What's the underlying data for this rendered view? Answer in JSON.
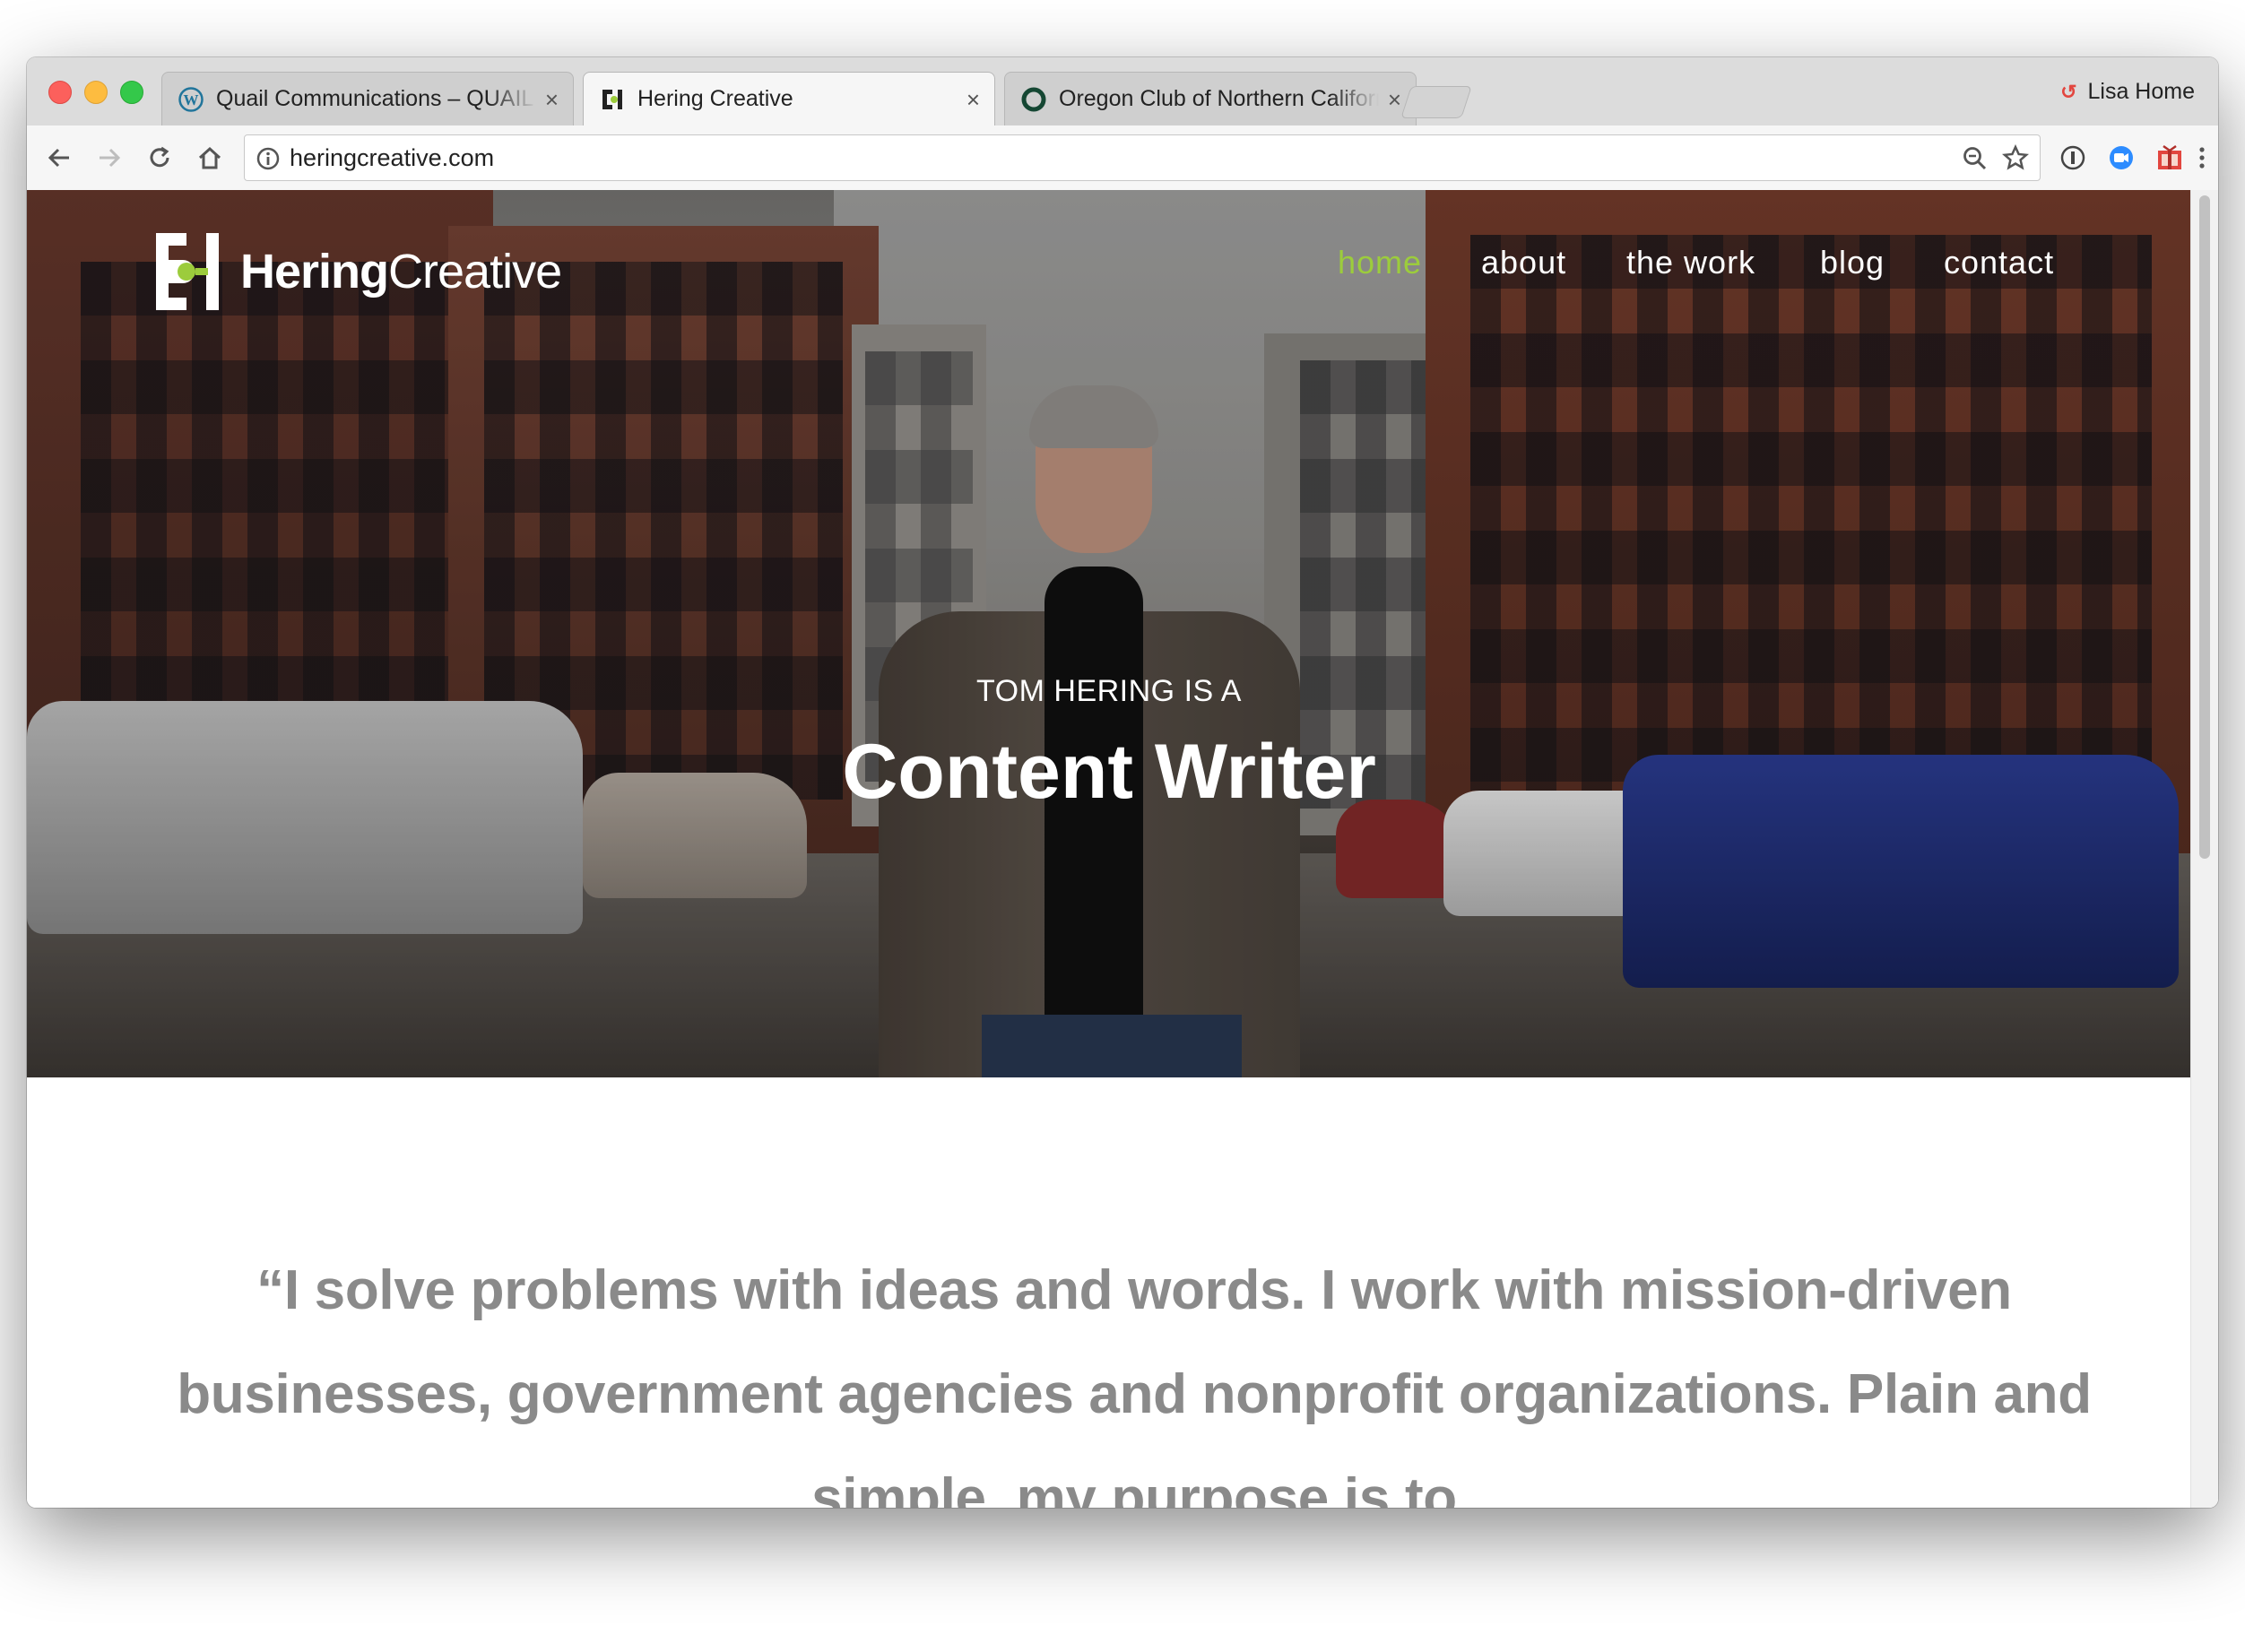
{
  "browser": {
    "tabs": [
      {
        "title": "Quail Communications – QUAIL",
        "favicon": "wordpress-icon",
        "active": false
      },
      {
        "title": "Hering Creative",
        "favicon": "hering-creative-icon",
        "active": true
      },
      {
        "title": "Oregon Club of Northern California",
        "favicon": "oregon-o-icon",
        "active": false
      }
    ],
    "profile_name": "Lisa Home",
    "url": "heringcreative.com",
    "colors": {
      "tabstrip": "#dcdcdc",
      "toolbar": "#f6f6f6"
    }
  },
  "site": {
    "logo": {
      "bold": "Hering",
      "light": "Creative"
    },
    "nav": [
      {
        "label": "home",
        "active": true
      },
      {
        "label": "about",
        "active": false
      },
      {
        "label": "the work",
        "active": false
      },
      {
        "label": "blog",
        "active": false
      },
      {
        "label": "contact",
        "active": false
      }
    ],
    "hero": {
      "kicker": "TOM HERING IS A",
      "title": "Content Writer"
    },
    "quote": "“I solve problems with ideas and words. I work with mission-driven businesses, government agencies and nonprofit organizations. Plain and simple, my purpose is to",
    "colors": {
      "accent": "#9ccc3c",
      "quote": "#8a8a8a"
    }
  }
}
